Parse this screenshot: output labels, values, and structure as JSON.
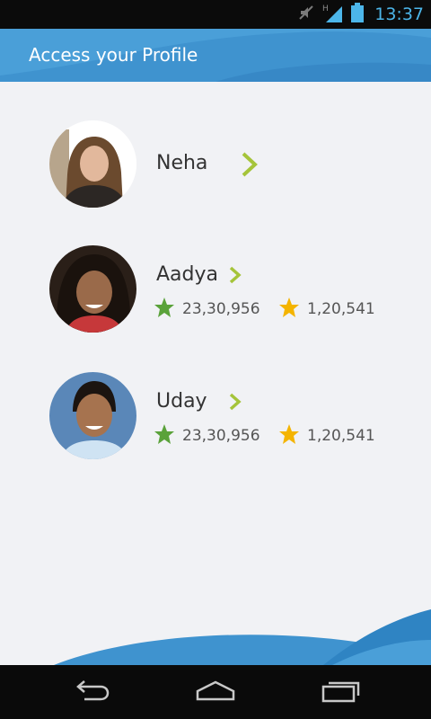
{
  "status_bar": {
    "time": "13:37",
    "icons": [
      "mute-icon",
      "signal-h-icon",
      "battery-icon"
    ]
  },
  "header": {
    "title": "Access your Profile",
    "color": "#3f93cf"
  },
  "profiles": [
    {
      "name": "Neha",
      "stats": []
    },
    {
      "name": "Aadya",
      "stats": [
        {
          "icon": "green-star-icon",
          "value": "23,30,956"
        },
        {
          "icon": "gold-star-icon",
          "value": "1,20,541"
        }
      ]
    },
    {
      "name": "Uday",
      "stats": [
        {
          "icon": "green-star-icon",
          "value": "23,30,956"
        },
        {
          "icon": "gold-star-icon",
          "value": "1,20,541"
        }
      ]
    }
  ],
  "colors": {
    "accent_chevron": "#a5c43a",
    "green_star": "#5aa23a",
    "gold_star": "#f4b400"
  },
  "nav_bar": {
    "buttons": [
      "back-icon",
      "home-icon",
      "recent-apps-icon"
    ]
  }
}
